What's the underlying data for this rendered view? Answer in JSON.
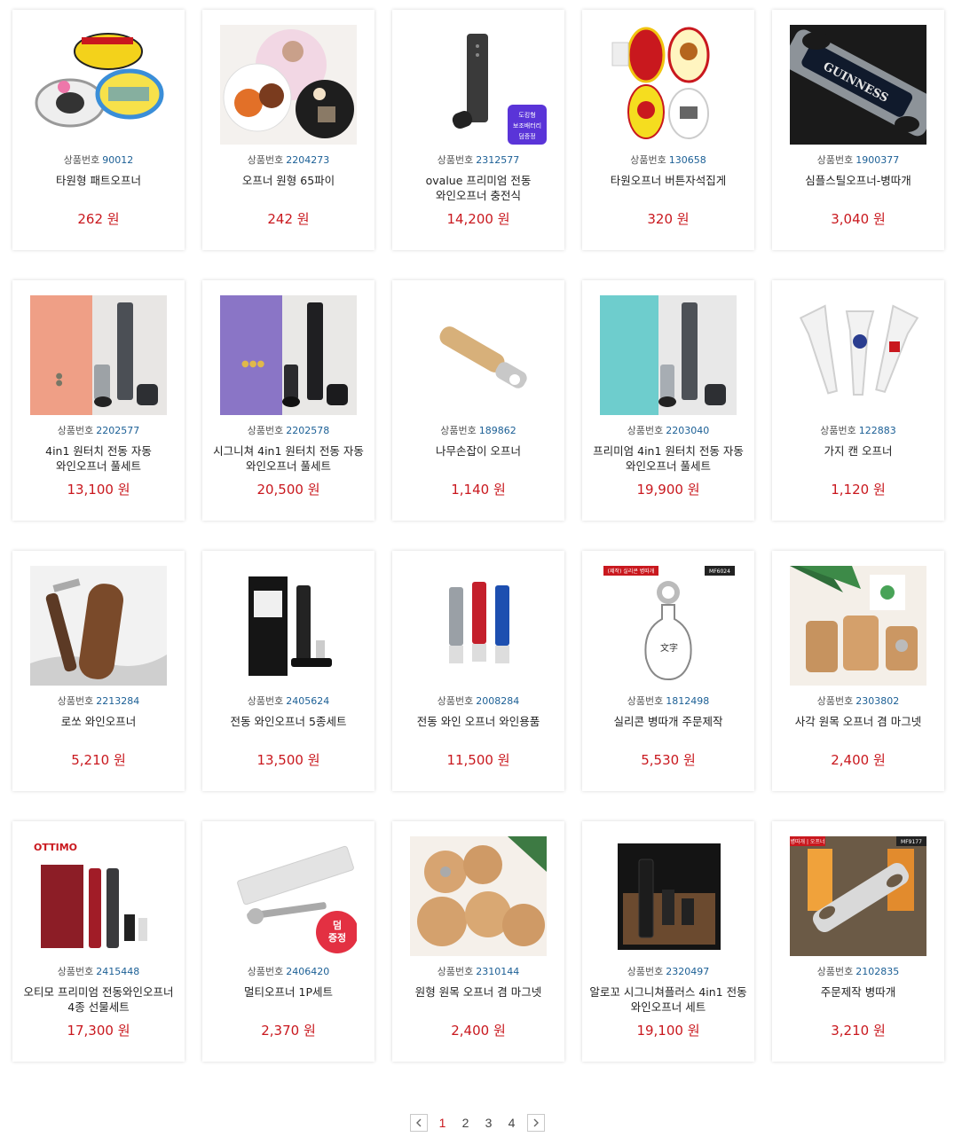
{
  "code_label": "상품번호",
  "currency": "원",
  "products": [
    {
      "code": "90012",
      "name": "타원형 패트오프너",
      "price": "262",
      "icon": "oval-pet-opener-image"
    },
    {
      "code": "2204273",
      "name": "오프너 원형 65파이",
      "price": "242",
      "icon": "round-opener-image"
    },
    {
      "code": "2312577",
      "name": "ovalue 프리미엄 전동 와인오프너 충전식",
      "price": "14,200",
      "icon": "electric-wine-opener-image",
      "badge": "도킹형 보조배터리 덤증정"
    },
    {
      "code": "130658",
      "name": "타원오프너 버튼자석집게",
      "price": "320",
      "icon": "oval-magnet-opener-image"
    },
    {
      "code": "1900377",
      "name": "심플스틸오프너-병따개",
      "price": "3,040",
      "icon": "steel-bottle-opener-image",
      "image_text": "GUINNESS"
    },
    {
      "code": "2202577",
      "name": "4in1 원터치 전동 자동 와인오프너 풀세트",
      "price": "13,100",
      "icon": "wine-opener-set-image"
    },
    {
      "code": "2202578",
      "name": "시그니쳐 4in1 원터치 전동 자동 와인오프너 풀세트",
      "price": "20,500",
      "icon": "signature-wine-set-image"
    },
    {
      "code": "189862",
      "name": "나무손잡이 오프너",
      "price": "1,140",
      "icon": "wooden-handle-opener-image"
    },
    {
      "code": "2203040",
      "name": "프리미엄 4in1 원터치 전동 자동 와인오프너 풀세트",
      "price": "19,900",
      "icon": "premium-wine-set-image"
    },
    {
      "code": "122883",
      "name": "가지 캔 오프너",
      "price": "1,120",
      "icon": "can-opener-image"
    },
    {
      "code": "2213284",
      "name": "로쏘 와인오프너",
      "price": "5,210",
      "icon": "sommelier-knife-image"
    },
    {
      "code": "2405624",
      "name": "전동 와인오프너 5종세트",
      "price": "13,500",
      "icon": "electric-wine-5set-image"
    },
    {
      "code": "2008284",
      "name": "전동 와인 오프너 와인용품",
      "price": "11,500",
      "icon": "colored-wine-openers-image"
    },
    {
      "code": "1812498",
      "name": "실리콘 병따개 주문제작",
      "price": "5,530",
      "icon": "silicone-opener-image",
      "image_text": "(제작) 실리콘 병따개",
      "image_tag": "MF6024"
    },
    {
      "code": "2303802",
      "name": "사각 원목 오프너 겸 마그넷",
      "price": "2,400",
      "icon": "square-wood-opener-image"
    },
    {
      "code": "2415448",
      "name": "오티모 프리미엄 전동와인오프너 4종 선물세트",
      "price": "17,300",
      "icon": "ottimo-set-image",
      "image_text": "OTTIMO"
    },
    {
      "code": "2406420",
      "name": "멀티오프너 1P세트",
      "price": "2,370",
      "icon": "multi-opener-image",
      "badge": "덤 증정"
    },
    {
      "code": "2310144",
      "name": "원형 원목 오프너 겸 마그넷",
      "price": "2,400",
      "icon": "round-wood-opener-image"
    },
    {
      "code": "2320497",
      "name": "알로꼬 시그니쳐플러스 4in1 전동 와인오프너 세트",
      "price": "19,100",
      "icon": "allocco-plus-set-image"
    },
    {
      "code": "2102835",
      "name": "주문제작 병따개",
      "price": "3,210",
      "icon": "custom-bottle-opener-image",
      "image_text": "병따개 | 오프너",
      "image_tag": "MF9177"
    }
  ],
  "pagination": {
    "pages": [
      "1",
      "2",
      "3",
      "4"
    ],
    "current": "1",
    "prev_icon": "chevron-left-icon",
    "next_icon": "chevron-right-icon"
  },
  "colors": {
    "price": "#c9181e",
    "code_number": "#1b5f95",
    "active_page": "#c9181e"
  }
}
